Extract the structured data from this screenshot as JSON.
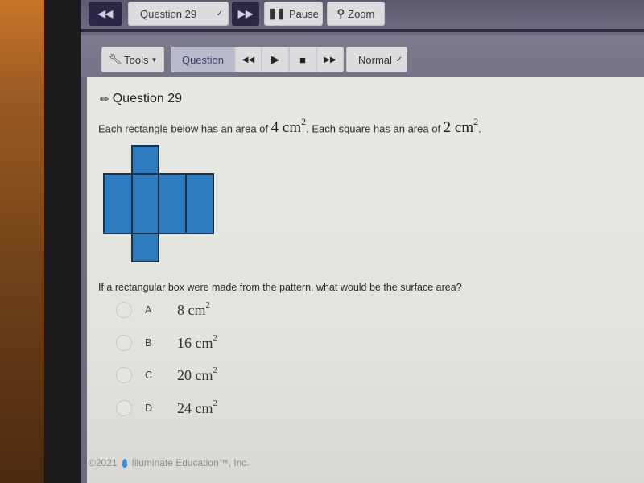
{
  "topbar": {
    "prev_icon": "double-chevron-left-icon",
    "question_select": {
      "selected": "Question 29"
    },
    "next_icon": "double-chevron-right-icon",
    "pause_label": "Pause",
    "pause_icon": "pause-icon",
    "zoom_label": "Zoom",
    "zoom_icon": "magnifier-icon"
  },
  "toolbar": {
    "tools_label": "Tools",
    "tools_icon": "wrench-icon",
    "question_label": "Question",
    "audio_controls": [
      "rewind-icon",
      "play-icon",
      "stop-icon",
      "fast-forward-icon"
    ],
    "speed_select": {
      "selected": "Normal"
    }
  },
  "question": {
    "title": "Question 29",
    "title_icon": "pencil-icon",
    "text_part1": "Each rectangle below has an area of ",
    "rect_area": "4 cm",
    "rect_area_exp": "2",
    "text_part2": ". Each square has an area of ",
    "square_area": "2 cm",
    "square_area_exp": "2",
    "text_part3": ".",
    "figure": {
      "description": "Net of a rectangular box: four rectangles in a row with two squares attached above and below the second rectangle",
      "fill_color": "#2f7bbf",
      "edge_color": "#1d3046"
    },
    "prompt": "If a rectangular box were made from the pattern, what would be the surface area?",
    "choices": [
      {
        "letter": "A",
        "value": "8 cm",
        "exp": "2"
      },
      {
        "letter": "B",
        "value": "16 cm",
        "exp": "2"
      },
      {
        "letter": "C",
        "value": "20 cm",
        "exp": "2"
      },
      {
        "letter": "D",
        "value": "24 cm",
        "exp": "2"
      }
    ]
  },
  "footer": {
    "text": "©2021",
    "company": "Illuminate Education™, Inc."
  }
}
